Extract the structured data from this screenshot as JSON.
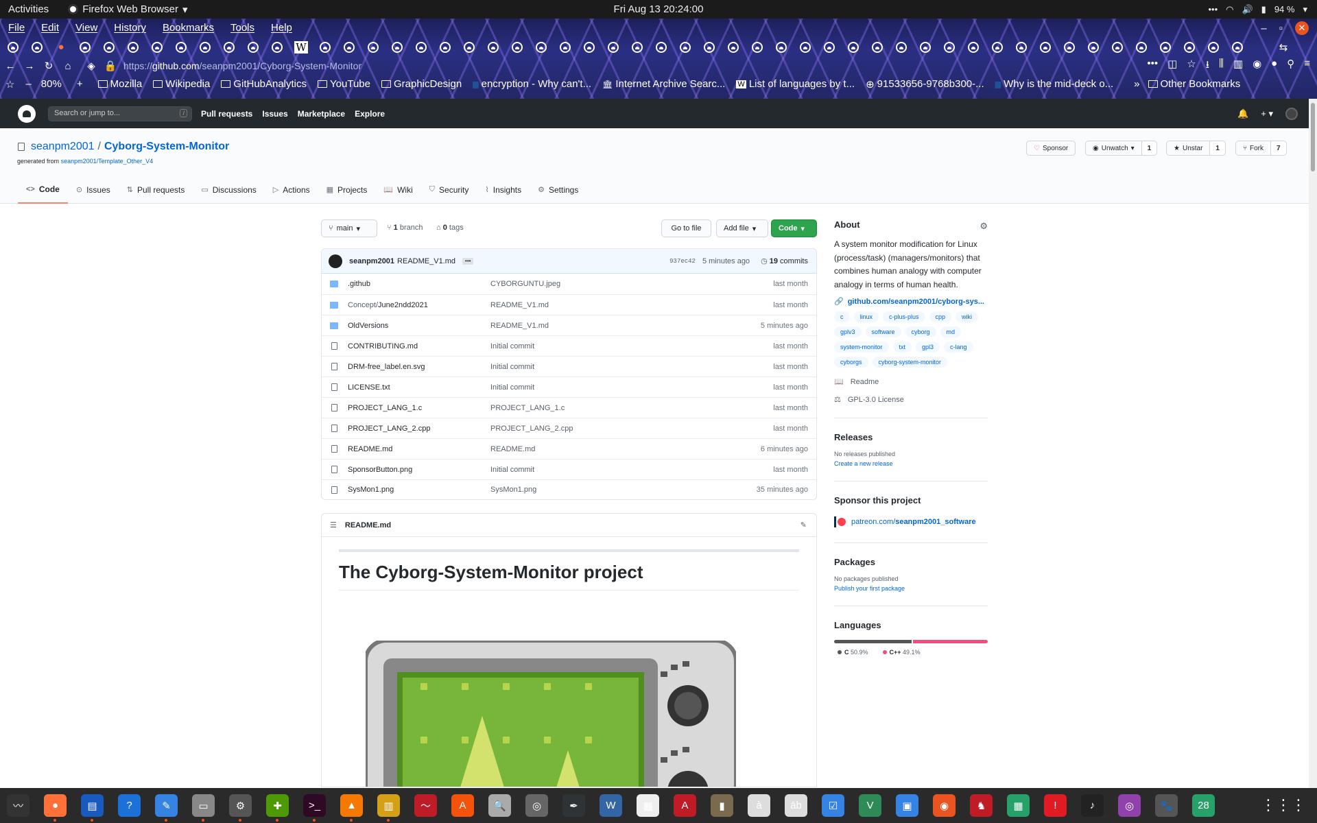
{
  "system": {
    "activities": "Activities",
    "app_name": "Firefox Web Browser",
    "clock": "Fri Aug 13  20:24:00",
    "battery": "94 %"
  },
  "browser": {
    "menu": [
      "File",
      "Edit",
      "View",
      "History",
      "Bookmarks",
      "Tools",
      "Help"
    ],
    "url_prefix": "https://",
    "url_host": "github.com",
    "url_path": "/seanpm2001/Cyborg-System-Monitor",
    "zoom": "80%",
    "bookmarks": [
      {
        "label": "Mozilla",
        "icon": "folder-icon"
      },
      {
        "label": "Wikipedia",
        "icon": "folder-icon"
      },
      {
        "label": "GitHubAnalytics",
        "icon": "folder-icon"
      },
      {
        "label": "YouTube",
        "icon": "folder-icon"
      },
      {
        "label": "GraphicDesign",
        "icon": "folder-icon"
      },
      {
        "label": "encryption - Why can't...",
        "icon": "stackexchange-icon"
      },
      {
        "label": "Internet Archive Searc...",
        "icon": "archive-icon"
      },
      {
        "label": "List of languages by t...",
        "icon": "wikipedia-icon"
      },
      {
        "label": "91533656-9768b300-...",
        "icon": "globe-icon"
      },
      {
        "label": "Why is the mid-deck o...",
        "icon": "stackexchange-icon"
      }
    ],
    "other_bookmarks": "Other Bookmarks"
  },
  "github": {
    "search_placeholder": "Search or jump to...",
    "search_key": "/",
    "nav": [
      "Pull requests",
      "Issues",
      "Marketplace",
      "Explore"
    ],
    "owner": "seanpm2001",
    "repo": "Cyborg-System-Monitor",
    "generated_from_label": "generated from",
    "generated_from_link": "seanpm2001/Template_Other_V4",
    "sponsor": "Sponsor",
    "unwatch": "Unwatch",
    "watch_count": "1",
    "unstar": "Unstar",
    "star_count": "1",
    "fork": "Fork",
    "fork_count": "7",
    "tabs": [
      {
        "label": "Code",
        "icon": "code-icon"
      },
      {
        "label": "Issues",
        "icon": "issue-icon"
      },
      {
        "label": "Pull requests",
        "icon": "pull-request-icon"
      },
      {
        "label": "Discussions",
        "icon": "discussion-icon"
      },
      {
        "label": "Actions",
        "icon": "actions-icon"
      },
      {
        "label": "Projects",
        "icon": "project-icon"
      },
      {
        "label": "Wiki",
        "icon": "book-icon"
      },
      {
        "label": "Security",
        "icon": "shield-icon"
      },
      {
        "label": "Insights",
        "icon": "graph-icon"
      },
      {
        "label": "Settings",
        "icon": "gear-icon"
      }
    ]
  },
  "files": {
    "branch": "main",
    "branch_count": "1",
    "branch_label": "branch",
    "tag_count": "0",
    "tag_label": "tags",
    "go_to_file": "Go to file",
    "add_file": "Add file",
    "code": "Code",
    "commit_author": "seanpm2001",
    "commit_message": "README_V1.md",
    "commit_sha": "937ec42",
    "commit_time": "5 minutes ago",
    "commit_count": "19",
    "commit_label": "commits",
    "rows": [
      {
        "type": "dir",
        "prefix": "",
        "name": ".github",
        "message": "CYBORGUNTU.jpeg",
        "age": "last month"
      },
      {
        "type": "dir",
        "prefix": "Concept/",
        "name": "June2ndd2021",
        "message": "README_V1.md",
        "age": "last month"
      },
      {
        "type": "dir",
        "prefix": "",
        "name": "OldVersions",
        "message": "README_V1.md",
        "age": "5 minutes ago"
      },
      {
        "type": "file",
        "prefix": "",
        "name": "CONTRIBUTING.md",
        "message": "Initial commit",
        "age": "last month"
      },
      {
        "type": "file",
        "prefix": "",
        "name": "DRM-free_label.en.svg",
        "message": "Initial commit",
        "age": "last month"
      },
      {
        "type": "file",
        "prefix": "",
        "name": "LICENSE.txt",
        "message": "Initial commit",
        "age": "last month"
      },
      {
        "type": "file",
        "prefix": "",
        "name": "PROJECT_LANG_1.c",
        "message": "PROJECT_LANG_1.c",
        "age": "last month"
      },
      {
        "type": "file",
        "prefix": "",
        "name": "PROJECT_LANG_2.cpp",
        "message": "PROJECT_LANG_2.cpp",
        "age": "last month"
      },
      {
        "type": "file",
        "prefix": "",
        "name": "README.md",
        "message": "README.md",
        "age": "6 minutes ago"
      },
      {
        "type": "file",
        "prefix": "",
        "name": "SponsorButton.png",
        "message": "Initial commit",
        "age": "last month"
      },
      {
        "type": "file",
        "prefix": "",
        "name": "SysMon1.png",
        "message": "SysMon1.png",
        "age": "35 minutes ago"
      }
    ],
    "readme_file": "README.md",
    "readme_title": "The Cyborg-System-Monitor project"
  },
  "sidebar": {
    "about_title": "About",
    "about_desc": "A system monitor modification for Linux (process/task) (managers/monitors) that combines human analogy with computer analogy in terms of human health.",
    "about_link": "github.com/seanpm2001/cyborg-sys...",
    "topics": [
      "c",
      "linux",
      "c-plus-plus",
      "cpp",
      "wiki",
      "gplv3",
      "software",
      "cyborg",
      "md",
      "system-monitor",
      "txt",
      "gpl3",
      "c-lang",
      "cyborgs",
      "cyborg-system-monitor"
    ],
    "readme": "Readme",
    "license": "GPL-3.0 License",
    "releases_title": "Releases",
    "no_releases": "No releases published",
    "create_release": "Create a new release",
    "sponsor_title": "Sponsor this project",
    "patreon_prefix": "patreon.com/",
    "patreon_user": "seanpm2001_software",
    "packages_title": "Packages",
    "no_packages": "No packages published",
    "publish_package": "Publish your first package",
    "languages_title": "Languages",
    "languages": [
      {
        "name": "C",
        "percent": "50.9%",
        "share": 50.9,
        "color": "#555555"
      },
      {
        "name": "C++",
        "percent": "49.1%",
        "share": 49.1,
        "color": "#f34b7d"
      }
    ]
  },
  "colors": {
    "accent": "#0366d6",
    "code_button": "#2ea44f",
    "active_tab_underline": "#f9826c",
    "gh_header": "#24292e"
  },
  "dock": [
    "system-monitor-icon",
    "firefox-icon",
    "writer-icon",
    "help-icon",
    "text-editor-icon",
    "files-icon",
    "settings-icon",
    "puzzle-icon",
    "terminal-icon",
    "vlc-icon",
    "archive-manager-icon",
    "sysprof-icon",
    "software-center-icon",
    "search-icon",
    "disk-icon",
    "inkscape-icon",
    "wordpad-icon",
    "document-viewer-icon",
    "pdf-icon",
    "zip-icon",
    "character-map-icon",
    "font-icon",
    "tasks-icon",
    "vim-icon",
    "screen-icon",
    "ubuntu-icon",
    "mario-icon",
    "calc-icon",
    "alert-icon",
    "music-icon",
    "screenshot-icon",
    "gimp-icon",
    "calendar-icon"
  ],
  "dock_calendar_day": "28"
}
